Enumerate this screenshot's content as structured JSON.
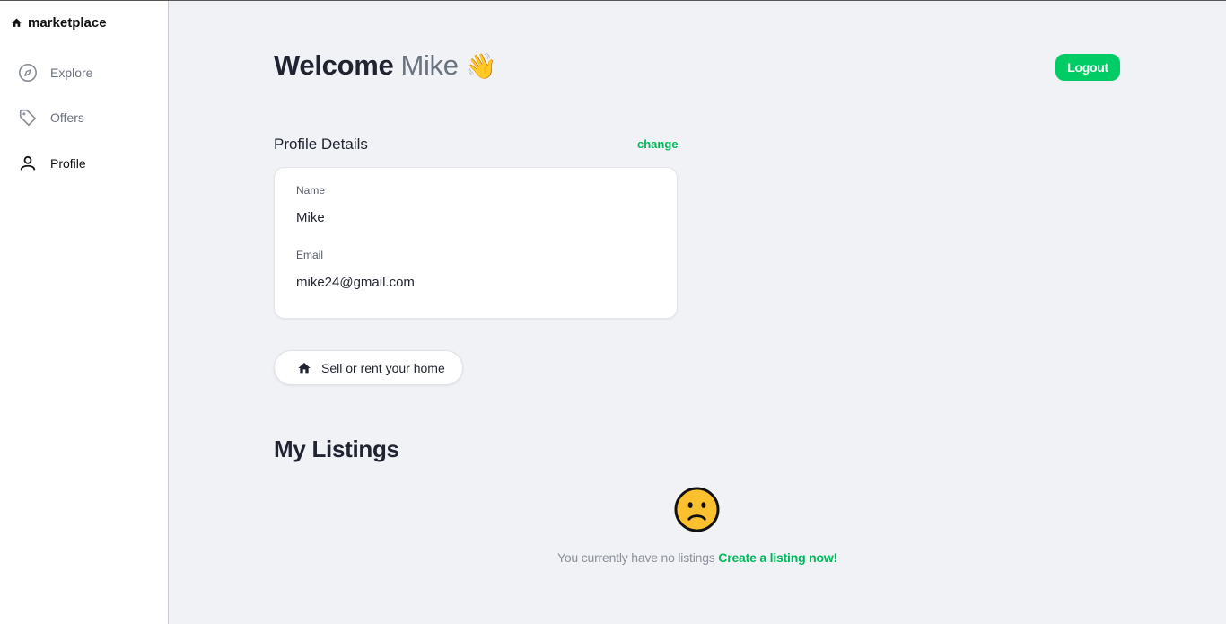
{
  "brand": {
    "name": "marketplace",
    "icon": "home-icon"
  },
  "sidebar": {
    "items": [
      {
        "label": "Explore",
        "icon": "compass-icon",
        "active": false
      },
      {
        "label": "Offers",
        "icon": "tag-icon",
        "active": false
      },
      {
        "label": "Profile",
        "icon": "person-icon",
        "active": true
      }
    ]
  },
  "header": {
    "welcome": "Welcome",
    "user_name": "Mike",
    "wave_emoji": "👋",
    "logout_label": "Logout"
  },
  "profile": {
    "section_title": "Profile Details",
    "change_label": "change",
    "name_label": "Name",
    "name_value": "Mike",
    "email_label": "Email",
    "email_value": "mike24@gmail.com"
  },
  "sell": {
    "label": "Sell or rent your home",
    "icon": "home-icon"
  },
  "listings": {
    "title": "My Listings",
    "empty_icon": "sad-face-icon",
    "empty_text": "You currently have no listings",
    "create_link": "Create a listing now!"
  },
  "colors": {
    "accent": "#00cc66",
    "background": "#f1f2f6",
    "sidebar_bg": "#ffffff"
  }
}
